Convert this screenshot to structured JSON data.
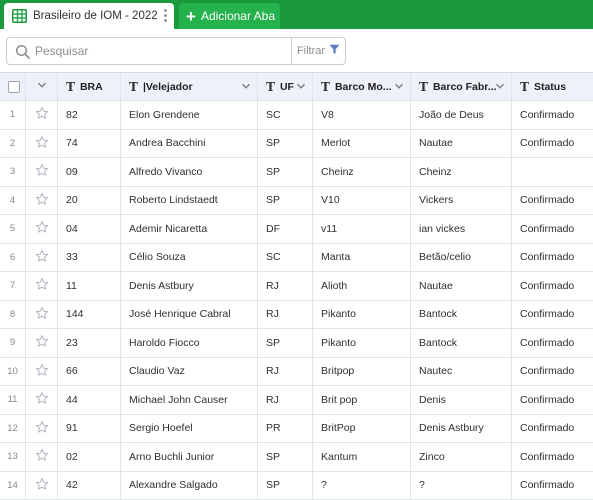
{
  "tabs": {
    "active_label": "Brasileiro de IOM - 2022",
    "add_label": "Adicionar Aba"
  },
  "toolbar": {
    "search_placeholder": "Pesquisar",
    "filter_label": "Filtrar"
  },
  "columns": [
    {
      "key": "bra",
      "label": "BRA"
    },
    {
      "key": "velejador",
      "label": "|Velejador"
    },
    {
      "key": "uf",
      "label": "UF"
    },
    {
      "key": "barco_modelo",
      "label": "Barco Mo..."
    },
    {
      "key": "barco_fabricante",
      "label": "Barco Fabr..."
    },
    {
      "key": "status",
      "label": "Status"
    }
  ],
  "rows": [
    {
      "n": "1",
      "bra": "82",
      "velejador": "Elon Grendene",
      "uf": "SC",
      "barco_modelo": "V8",
      "barco_fabricante": "João de Deus",
      "status": "Confirmado"
    },
    {
      "n": "2",
      "bra": "74",
      "velejador": "Andrea Bacchini",
      "uf": "SP",
      "barco_modelo": "Merlot",
      "barco_fabricante": "Nautae",
      "status": "Confirmado"
    },
    {
      "n": "3",
      "bra": "09",
      "velejador": "Alfredo Vivanco",
      "uf": "SP",
      "barco_modelo": "Cheinz",
      "barco_fabricante": "Cheinz",
      "status": ""
    },
    {
      "n": "4",
      "bra": "20",
      "velejador": "Roberto Lindstaedt",
      "uf": "SP",
      "barco_modelo": "V10",
      "barco_fabricante": "Vickers",
      "status": "Confirmado"
    },
    {
      "n": "5",
      "bra": "04",
      "velejador": "Ademir Nicaretta",
      "uf": "DF",
      "barco_modelo": "v11",
      "barco_fabricante": "ian vickes",
      "status": "Confirmado"
    },
    {
      "n": "6",
      "bra": "33",
      "velejador": "Célio Souza",
      "uf": "SC",
      "barco_modelo": "Manta",
      "barco_fabricante": "Betão/celio",
      "status": "Confirmado"
    },
    {
      "n": "7",
      "bra": "11",
      "velejador": "Denis Astbury",
      "uf": "RJ",
      "barco_modelo": "Alioth",
      "barco_fabricante": "Nautae",
      "status": "Confirmado"
    },
    {
      "n": "8",
      "bra": "144",
      "velejador": "José Henrique Cabral",
      "uf": "RJ",
      "barco_modelo": "Pikanto",
      "barco_fabricante": "Bantock",
      "status": "Confirmado"
    },
    {
      "n": "9",
      "bra": "23",
      "velejador": "Haroldo Fiocco",
      "uf": "SP",
      "barco_modelo": "Pikanto",
      "barco_fabricante": "Bantock",
      "status": "Confirmado"
    },
    {
      "n": "10",
      "bra": "66",
      "velejador": "Claudio Vaz",
      "uf": "RJ",
      "barco_modelo": "Britpop",
      "barco_fabricante": "Nautec",
      "status": "Confirmado"
    },
    {
      "n": "11",
      "bra": "44",
      "velejador": "Michael John Causer",
      "uf": "RJ",
      "barco_modelo": "Brit pop",
      "barco_fabricante": "Denis",
      "status": "Confirmado"
    },
    {
      "n": "12",
      "bra": "91",
      "velejador": "Sergio Hoefel",
      "uf": "PR",
      "barco_modelo": "BritPop",
      "barco_fabricante": "Denis Astbury",
      "status": "Confirmado"
    },
    {
      "n": "13",
      "bra": "02",
      "velejador": "Arno Buchli Junior",
      "uf": "SP",
      "barco_modelo": "Kantum",
      "barco_fabricante": "Zinco",
      "status": "Confirmado"
    },
    {
      "n": "14",
      "bra": "42",
      "velejador": "Alexandre Salgado",
      "uf": "SP",
      "barco_modelo": "?",
      "barco_fabricante": "?",
      "status": "Confirmado"
    }
  ],
  "colors": {
    "brand_green": "#1a9a3d",
    "add_tab_green": "#25b24c",
    "header_bg": "#eef0fa"
  },
  "icons": {
    "tab": "spreadsheet-icon",
    "add": "plus-icon",
    "search": "search-icon",
    "filter": "funnel-icon",
    "row": "star-icon",
    "text_column": "text-type-icon",
    "header_dropdown": "chevron-down-icon"
  }
}
